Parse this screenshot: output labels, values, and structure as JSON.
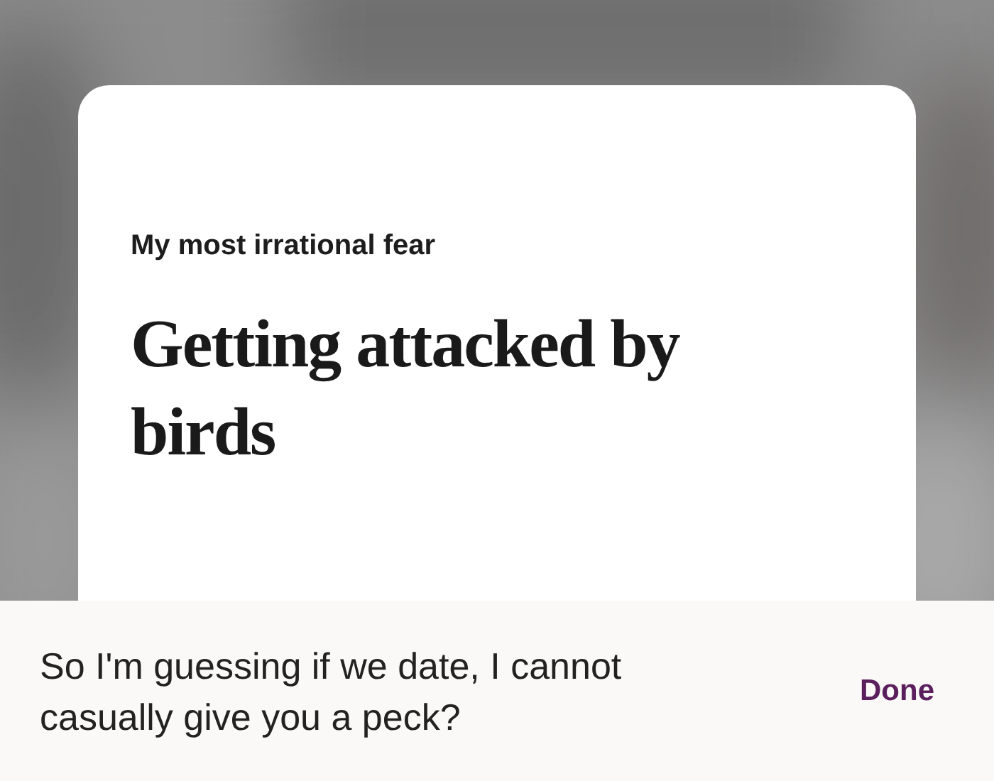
{
  "prompt": {
    "question": "My most irrational fear",
    "answer": "Getting attacked by birds"
  },
  "reply": {
    "value": "So I'm guessing if we date, I cannot casually give you a peck?",
    "button": "Done"
  }
}
